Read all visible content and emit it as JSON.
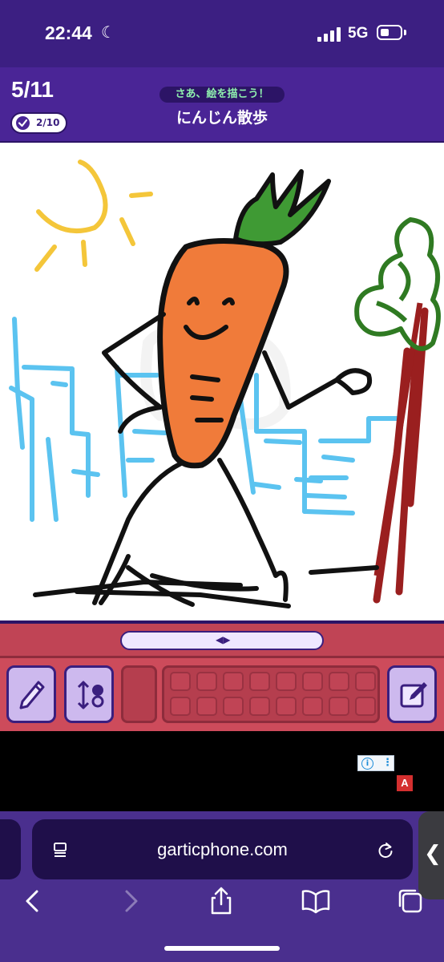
{
  "status_bar": {
    "time": "22:44",
    "moon_icon": "moon-icon",
    "network": "5G",
    "battery_icon": "battery-icon"
  },
  "game_header": {
    "round": "5/11",
    "completed_count": "2/10",
    "prompt_label": "さあ、絵を描こう！",
    "prompt_text": "にんじん散歩",
    "timer_icon": "timer-icon"
  },
  "canvas": {
    "description_icon": "drawing-canvas"
  },
  "toolbar": {
    "slider_arrows": "◀▶",
    "tools": [
      "pencil-icon",
      "thickness-icon",
      "edit-icon"
    ],
    "palette_slots": 14
  },
  "ad": {
    "info_label": "i",
    "menu_label": "⋮",
    "badge": "A"
  },
  "browser": {
    "url": "garticphone.com",
    "nav": [
      "back-icon",
      "forward-icon",
      "share-icon",
      "bookmarks-icon",
      "tabs-icon"
    ]
  },
  "colors": {
    "header_bg": "#4a2596",
    "toolbar_bg": "#cd4b5b",
    "accent_green": "#8ff0ae",
    "carrot": "#f07b3a",
    "leaves": "#3f9a34",
    "sky_blue": "#5bc3f0",
    "sun": "#f4c63a",
    "tree_trunk": "#9a1f1f",
    "tree_leaves": "#2f7a22"
  }
}
